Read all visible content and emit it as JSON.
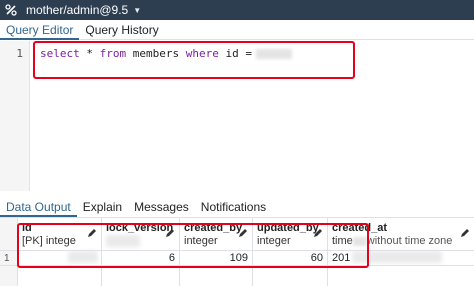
{
  "titlebar": {
    "connection": "mother/admin@9.5"
  },
  "query_tabs": [
    {
      "label": "Query Editor",
      "active": true
    },
    {
      "label": "Query History",
      "active": false
    }
  ],
  "editor": {
    "line_number": "1",
    "code": {
      "kw_select": "select",
      "star": "*",
      "kw_from": "from",
      "table": "members",
      "kw_where": "where",
      "column": "id",
      "op": "="
    }
  },
  "output_tabs": [
    {
      "label": "Data Output",
      "active": true
    },
    {
      "label": "Explain",
      "active": false
    },
    {
      "label": "Messages",
      "active": false
    },
    {
      "label": "Notifications",
      "active": false
    }
  ],
  "grid": {
    "columns": [
      {
        "name": "id",
        "type": "[PK] intege"
      },
      {
        "name": "lock_version",
        "type": ""
      },
      {
        "name": "created_by",
        "type": "integer"
      },
      {
        "name": "updated_by",
        "type": "integer"
      },
      {
        "name": "created_at",
        "type": "time"
      },
      {
        "name": "",
        "type": "without time zone"
      }
    ],
    "row_number": "1",
    "row": {
      "lock_version": "6",
      "created_by": "109",
      "updated_by": "60",
      "created_at": "201"
    }
  },
  "colors": {
    "accent": "#326690",
    "titlebar": "#2c3e50",
    "highlight_box": "#e5001c",
    "keyword": "#7a1fa2"
  }
}
